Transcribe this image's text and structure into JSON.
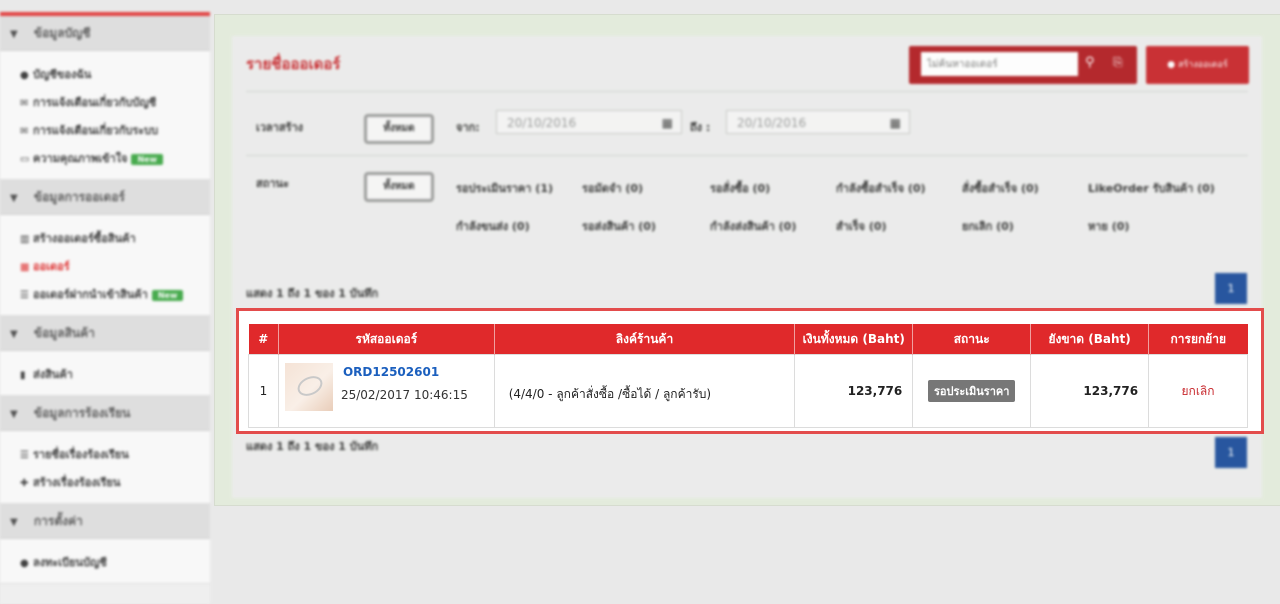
{
  "sidebar": {
    "sections": [
      {
        "title": "ข้อมูลบัญชี",
        "items": [
          {
            "label": "บัญชีของฉัน",
            "icon": "user-icon"
          },
          {
            "label": "การแจ้งเตือนเกี่ยวกับบัญชี",
            "icon": "mail-icon"
          },
          {
            "label": "การแจ้งเตือนเกี่ยวกับระบบ",
            "icon": "mail-icon"
          },
          {
            "label": "ความคุณภาพเข้าใจ",
            "icon": "card-icon",
            "badge": "New"
          }
        ]
      },
      {
        "title": "ข้อมูลการออเดอร์",
        "items": [
          {
            "label": "สร้างออเดอร์ซื้อสินค้า",
            "icon": "chart-icon"
          },
          {
            "label": "ออเดอร์",
            "icon": "grid-icon",
            "active": true
          },
          {
            "label": "ออเดอร์ฝากนำเข้าสินค้า",
            "icon": "list-icon",
            "badge": "New"
          }
        ]
      },
      {
        "title": "ข้อมูลสินค้า",
        "items": [
          {
            "label": "ส่งสินค้า",
            "icon": "book-icon"
          }
        ]
      },
      {
        "title": "ข้อมูลการร้องเรียน",
        "items": [
          {
            "label": "รายชื่อเรื่องร้องเรียน",
            "icon": "list-icon"
          },
          {
            "label": "สร้างเรื่องร้องเรียน",
            "icon": "plus-icon"
          }
        ]
      },
      {
        "title": "การตั้งค่า",
        "items": [
          {
            "label": "ลงทะเบียนบัญชี",
            "icon": "user-icon"
          }
        ]
      }
    ]
  },
  "header": {
    "title": "รายชื่อออเดอร์",
    "search_placeholder": "ไม่ค้นหาออเดอร์",
    "create_button": "สร้างออเดอร์"
  },
  "filters": {
    "time_label": "เวลาสร้าง",
    "all_label": "ทั้งหมด",
    "from_label": "จาก:",
    "to_label": "ถึง :",
    "date_from": "20/10/2016",
    "date_to": "20/10/2016",
    "status_label": "สถานะ",
    "statuses": [
      "รอประเมินราคา (1)",
      "รอมัดจำ (0)",
      "รอสั่งซื้อ (0)",
      "กำลังซื้อสำเร็จ (0)",
      "สั่งซื้อสำเร็จ (0)",
      "LikeOrder รับสินค้า (0)",
      "กำลังขนส่ง (0)",
      "รอส่งสินค้า (0)",
      "กำลังส่งสินค้า (0)",
      "สำเร็จ (0)",
      "ยกเลิก (0)",
      "หาย (0)"
    ]
  },
  "pagination": {
    "summary": "แสดง 1 ถึง 1 ของ 1 บันทึก",
    "page": "1"
  },
  "table": {
    "headers": [
      "#",
      "รหัสออเดอร์",
      "ลิงค์ร้านค้า",
      "เงินทั้งหมด (Baht)",
      "สถานะ",
      "ยังขาด (Baht)",
      "การยกย้าย"
    ],
    "rows": [
      {
        "index": "1",
        "order_id": "ORD12502601",
        "date": "25/02/2017 10:46:15",
        "shop": "(4/4/0 - ลูกค้าสั่งซื้อ /ซื้อได้ / ลูกค้ารับ)",
        "total": "123,776",
        "status": "รอประเมินราคา",
        "remaining": "123,776",
        "action": "ยกเลิก"
      }
    ]
  },
  "colors": {
    "accent": "#e0292b",
    "link": "#1b5fbe",
    "pagination": "#1e4f9c",
    "badge_new": "#3aa641"
  }
}
